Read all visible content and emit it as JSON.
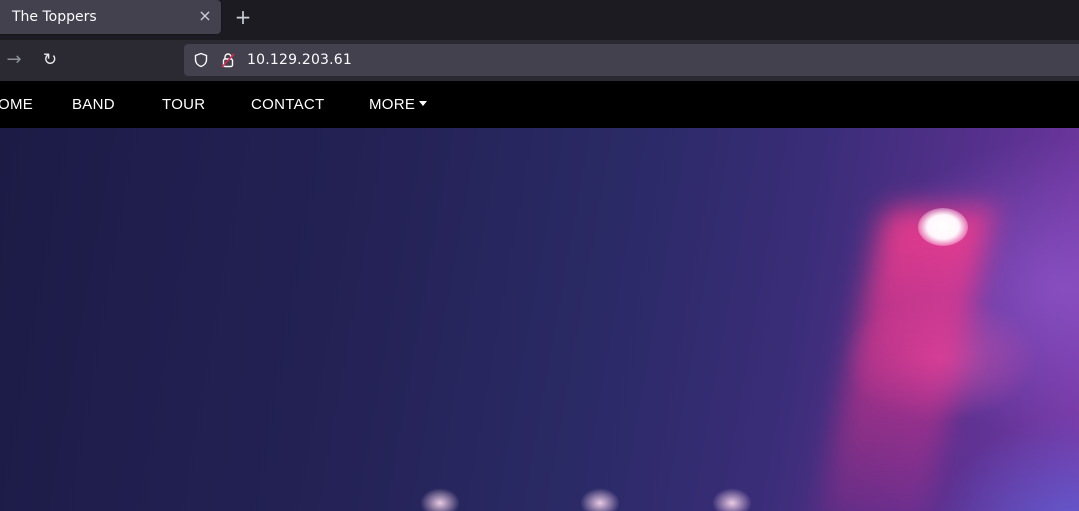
{
  "browser": {
    "tab": {
      "title": "The Toppers",
      "close_glyph": "×"
    },
    "new_tab_glyph": "+",
    "nav": {
      "forward_glyph": "→",
      "reload_glyph": "↻"
    },
    "url": "10.129.203.61",
    "icons": [
      "shield-icon",
      "insecure-lock-icon"
    ]
  },
  "site": {
    "nav": [
      "OME",
      "BAND",
      "TOUR",
      "CONTACT",
      "MORE"
    ],
    "accent": "#000000"
  }
}
